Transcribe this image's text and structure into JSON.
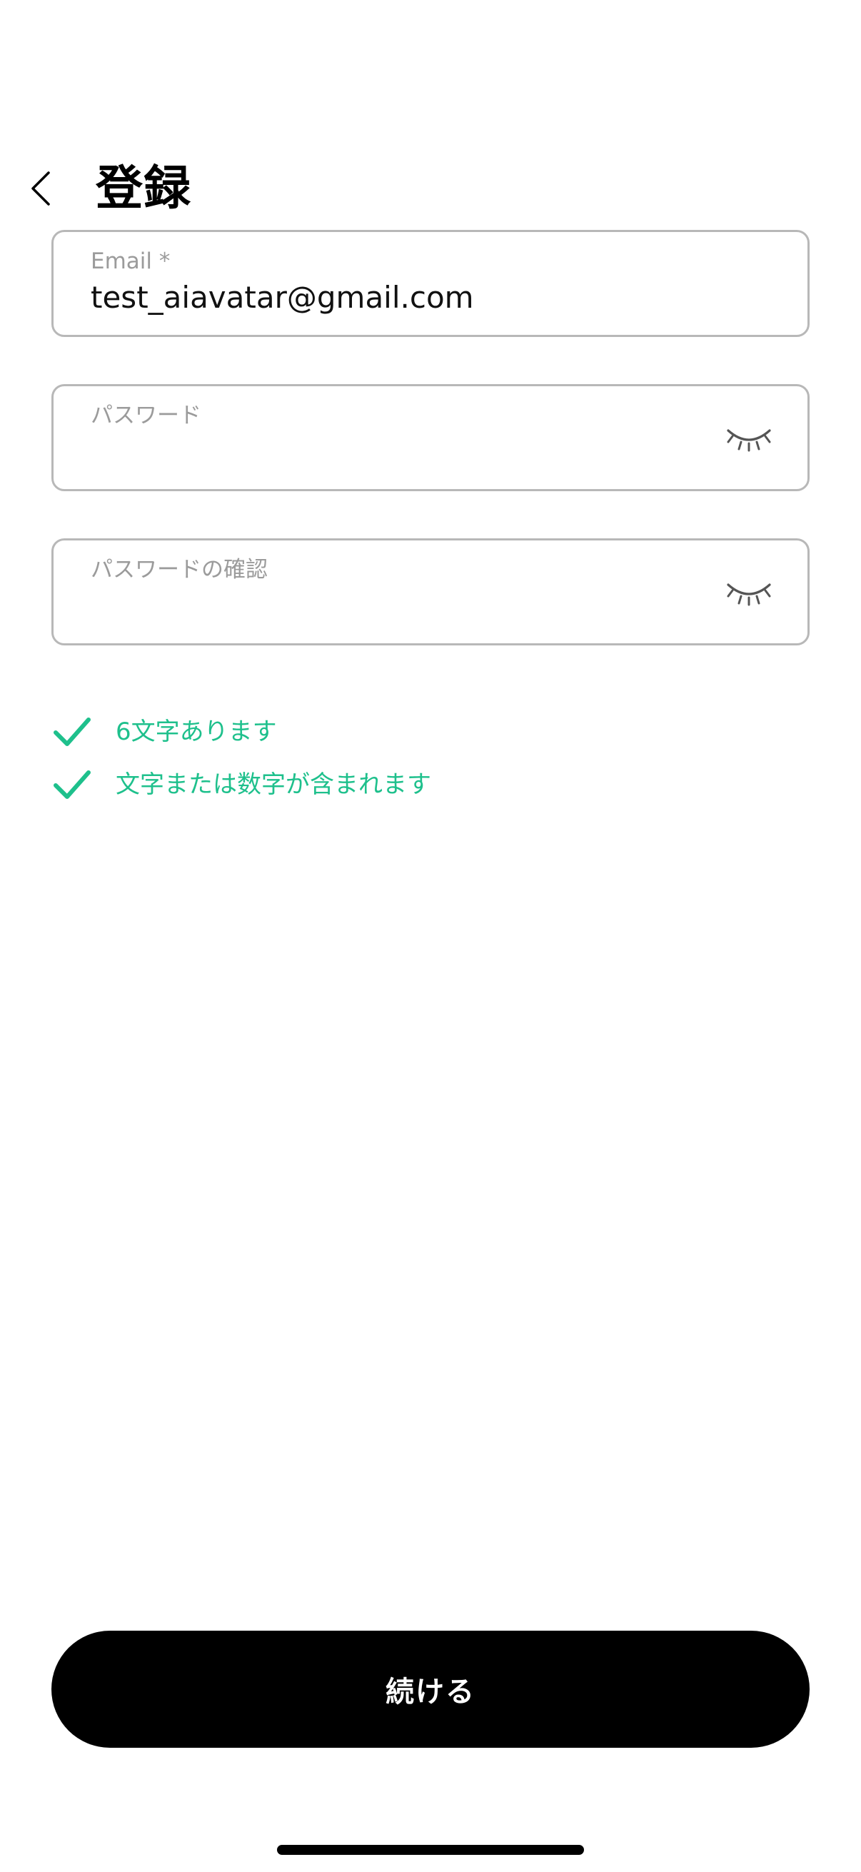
{
  "header": {
    "title": "登録",
    "back_icon": "chevron-left-icon"
  },
  "form": {
    "email": {
      "label": "Email *",
      "value": "test_aiavatar@gmail.com"
    },
    "password": {
      "label": "パスワード",
      "value": "",
      "toggle_icon": "eye-closed-icon"
    },
    "confirm_password": {
      "label": "パスワードの確認",
      "value": "",
      "toggle_icon": "eye-closed-icon"
    }
  },
  "requirements": [
    {
      "text": "6文字あります",
      "met": true
    },
    {
      "text": "文字または数字が含まれます",
      "met": true
    }
  ],
  "actions": {
    "continue_label": "続ける"
  },
  "colors": {
    "success": "#1ec08c",
    "primary_button": "#000000",
    "border": "#b8b8b8",
    "label": "#9b9b9b"
  }
}
